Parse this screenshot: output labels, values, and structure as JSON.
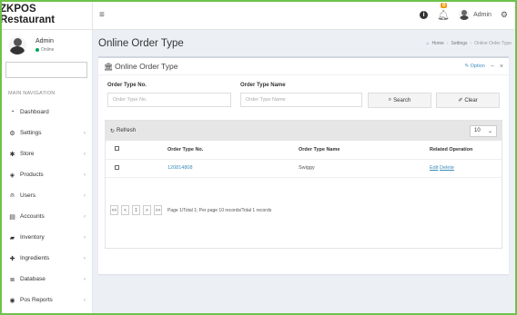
{
  "app": {
    "name": "ZKPOS Restaurant"
  },
  "header": {
    "menu_icon": "hamburger-icon",
    "notification_count": "0",
    "user_label": "Admin"
  },
  "sidebar": {
    "user": {
      "name": "Admin",
      "status": "Online"
    },
    "search_placeholder": "",
    "nav_header": "MAIN NAVIGATION",
    "items": [
      {
        "label": "Dashboard",
        "icon": "dashboard-icon"
      },
      {
        "label": "Settings",
        "icon": "gear-icon"
      },
      {
        "label": "Store",
        "icon": "store-icon"
      },
      {
        "label": "Products",
        "icon": "products-icon"
      },
      {
        "label": "Users",
        "icon": "users-icon"
      },
      {
        "label": "Accounts",
        "icon": "accounts-icon"
      },
      {
        "label": "Inventory",
        "icon": "inventory-icon"
      },
      {
        "label": "Ingredients",
        "icon": "ingredients-icon"
      },
      {
        "label": "Database",
        "icon": "database-icon"
      },
      {
        "label": "Pos Reports",
        "icon": "reports-icon"
      }
    ]
  },
  "page": {
    "title": "Online Order Type",
    "breadcrumb": [
      "Home",
      "Settings",
      "Online Order Type"
    ]
  },
  "box": {
    "title": "Online Order Type",
    "option_label": "Option",
    "filters": {
      "order_type_no_label": "Order Type No.",
      "order_type_no_placeholder": "Order Type No.",
      "order_type_name_label": "Order Type Name",
      "order_type_name_placeholder": "Order Type Name",
      "search_label": "Search",
      "clear_label": "Clear"
    }
  },
  "grid": {
    "refresh_label": "Refresh",
    "page_size": "10",
    "columns": [
      "Order Type No.",
      "Order Type Name",
      "Related Operation"
    ],
    "rows": [
      {
        "order_type_no": "120814808",
        "order_type_name": "Swiggy",
        "edit": "Edit",
        "delete": "Delete"
      }
    ],
    "pager": {
      "first": "<<",
      "prev": "<",
      "page": "1",
      "next": ">",
      "last": ">>",
      "info": "Page 1/Total 1; Per page 10 records/Total 1 records"
    }
  }
}
